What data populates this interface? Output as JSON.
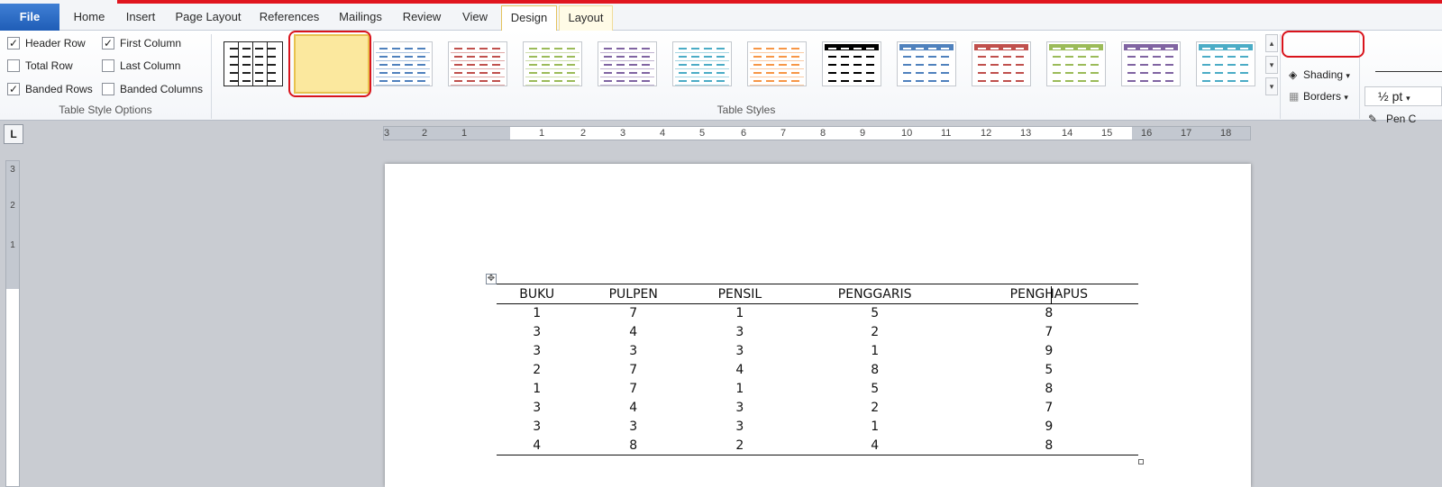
{
  "tabs": {
    "file": "File",
    "home": "Home",
    "insert": "Insert",
    "page_layout": "Page Layout",
    "references": "References",
    "mailings": "Mailings",
    "review": "Review",
    "view": "View",
    "design": "Design",
    "layout": "Layout"
  },
  "table_style_options": {
    "group_label": "Table Style Options",
    "header_row": {
      "label": "Header Row",
      "checked": true
    },
    "total_row": {
      "label": "Total Row",
      "checked": false
    },
    "banded_rows": {
      "label": "Banded Rows",
      "checked": true
    },
    "first_column": {
      "label": "First Column",
      "checked": true
    },
    "last_column": {
      "label": "Last Column",
      "checked": false
    },
    "banded_columns": {
      "label": "Banded Columns",
      "checked": false
    }
  },
  "table_styles": {
    "group_label": "Table Styles",
    "accent_colors": [
      "#222222",
      "#555555",
      "#4f81bd",
      "#c0504d",
      "#9bbb59",
      "#8064a2",
      "#4bacc6",
      "#f79646",
      "#000000",
      "#4f81bd",
      "#c0504d",
      "#9bbb59",
      "#8064a2",
      "#4bacc6"
    ]
  },
  "draw_borders": {
    "shading_label": "Shading",
    "borders_label": "Borders",
    "pen_weight": "½ pt",
    "pen_color_label": "Pen C"
  },
  "ruler": {
    "corner_symbol": "L",
    "h_numbers": [
      "3",
      "2",
      "1",
      "1",
      "2",
      "3",
      "4",
      "5",
      "6",
      "7",
      "8",
      "9",
      "10",
      "11",
      "12",
      "13",
      "14",
      "15",
      "16",
      "17",
      "18"
    ],
    "v_numbers": [
      "3",
      "2",
      "1"
    ]
  },
  "document_table": {
    "headers": [
      "BUKU",
      "PULPEN",
      "PENSIL",
      "PENGGARIS",
      "PENGHAPUS"
    ],
    "rows": [
      [
        "1",
        "7",
        "1",
        "5",
        "8"
      ],
      [
        "3",
        "4",
        "3",
        "2",
        "7"
      ],
      [
        "3",
        "3",
        "3",
        "1",
        "9"
      ],
      [
        "2",
        "7",
        "4",
        "8",
        "5"
      ],
      [
        "1",
        "7",
        "1",
        "5",
        "8"
      ],
      [
        "3",
        "4",
        "3",
        "2",
        "7"
      ],
      [
        "3",
        "3",
        "3",
        "1",
        "9"
      ],
      [
        "4",
        "8",
        "2",
        "4",
        "8"
      ]
    ]
  },
  "colors": {
    "annotation_red": "#d9141c",
    "selection_gold": "#e7c24f",
    "file_tab_blue": "#2a6cc7"
  }
}
